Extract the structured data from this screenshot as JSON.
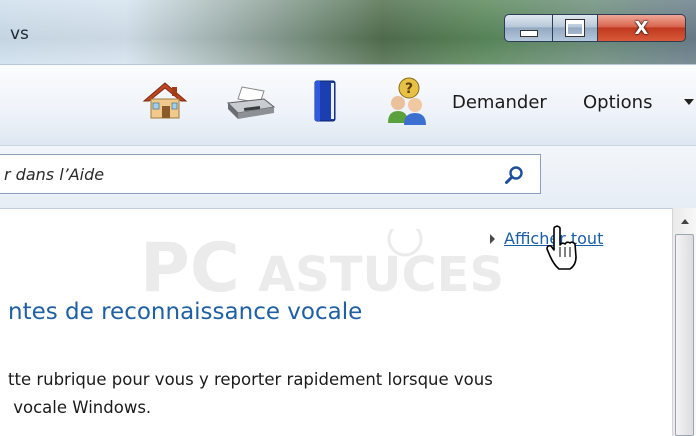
{
  "window": {
    "title_fragment": "vs",
    "controls": {
      "minimize": "minimize",
      "maximize": "maximize",
      "close": "X"
    }
  },
  "toolbar": {
    "icons": [
      "home-icon",
      "print-icon",
      "browse-help-icon",
      "ask-icon"
    ],
    "ask_label": "Demander",
    "options_label": "Options"
  },
  "search": {
    "placeholder": "r dans l’Aide",
    "value": ""
  },
  "content": {
    "show_all": "Afficher tout",
    "heading": "ntes de reconnaissance vocale",
    "paragraph_line1": "tte rubrique pour vous y reporter rapidement lorsque vous",
    "paragraph_line2": " vocale Windows.",
    "watermark": "PC ASTUCES"
  },
  "colors": {
    "link": "#1a5ea8",
    "heading": "#1f5fa3",
    "close_button": "#c0391f"
  }
}
